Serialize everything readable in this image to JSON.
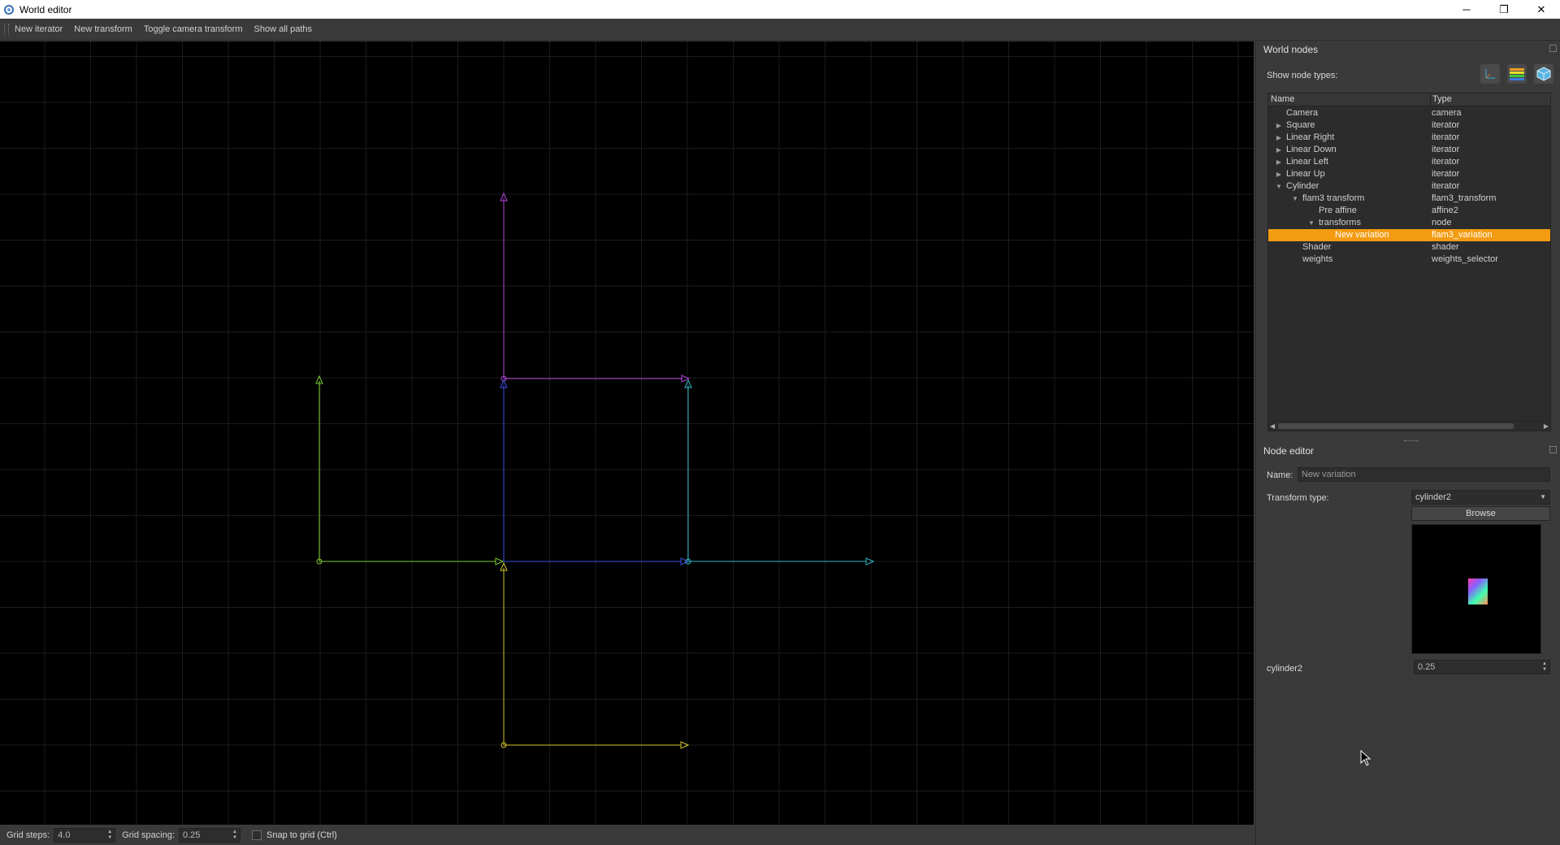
{
  "window": {
    "title": "World editor",
    "controls": {
      "minimize": "─",
      "restore": "❐",
      "close": "✕"
    }
  },
  "toolbar": {
    "items": [
      "New iterator",
      "New transform",
      "Toggle camera transform",
      "Show all paths"
    ]
  },
  "statusbar": {
    "grid_steps_label": "Grid steps:",
    "grid_steps_value": "4.0",
    "grid_spacing_label": "Grid spacing:",
    "grid_spacing_value": "0.25",
    "snap_label": "Snap to grid (Ctrl)"
  },
  "world_nodes": {
    "title": "World nodes",
    "show_types_label": "Show node types:",
    "type_icons": [
      "transform-axes-icon",
      "color-bands-icon",
      "cube-icon"
    ],
    "columns": {
      "name": "Name",
      "type": "Type"
    },
    "rows": [
      {
        "name": "Camera",
        "type": "camera",
        "depth": 0,
        "expander": "none",
        "selected": false
      },
      {
        "name": "Square",
        "type": "iterator",
        "depth": 0,
        "expander": "collapsed",
        "selected": false
      },
      {
        "name": "Linear Right",
        "type": "iterator",
        "depth": 0,
        "expander": "collapsed",
        "selected": false
      },
      {
        "name": "Linear Down",
        "type": "iterator",
        "depth": 0,
        "expander": "collapsed",
        "selected": false
      },
      {
        "name": "Linear Left",
        "type": "iterator",
        "depth": 0,
        "expander": "collapsed",
        "selected": false
      },
      {
        "name": "Linear Up",
        "type": "iterator",
        "depth": 0,
        "expander": "collapsed",
        "selected": false
      },
      {
        "name": "Cylinder",
        "type": "iterator",
        "depth": 0,
        "expander": "expanded",
        "selected": false
      },
      {
        "name": "flam3 transform",
        "type": "flam3_transform",
        "depth": 1,
        "expander": "expanded",
        "selected": false
      },
      {
        "name": "Pre affine",
        "type": "affine2",
        "depth": 2,
        "expander": "none",
        "selected": false
      },
      {
        "name": "transforms",
        "type": "node",
        "depth": 2,
        "expander": "expanded",
        "selected": false
      },
      {
        "name": "New variation",
        "type": "flam3_variation",
        "depth": 3,
        "expander": "none",
        "selected": true
      },
      {
        "name": "Shader",
        "type": "shader",
        "depth": 1,
        "expander": "none",
        "selected": false
      },
      {
        "name": "weights",
        "type": "weights_selector",
        "depth": 1,
        "expander": "none",
        "selected": false
      }
    ]
  },
  "node_editor": {
    "title": "Node editor",
    "name_label": "Name:",
    "name_value": "New variation",
    "transform_type_label": "Transform type:",
    "transform_type_value": "cylinder2",
    "browse_label": "Browse",
    "param_label": "cylinder2",
    "param_value": "0.25"
  },
  "colors": {
    "selection": "#f39c12",
    "path_purple": "#b043d8",
    "path_green": "#7ccb2e",
    "path_blue": "#3a4fe0",
    "path_cyan": "#2eb8c8",
    "path_yellow": "#d2c62a"
  }
}
